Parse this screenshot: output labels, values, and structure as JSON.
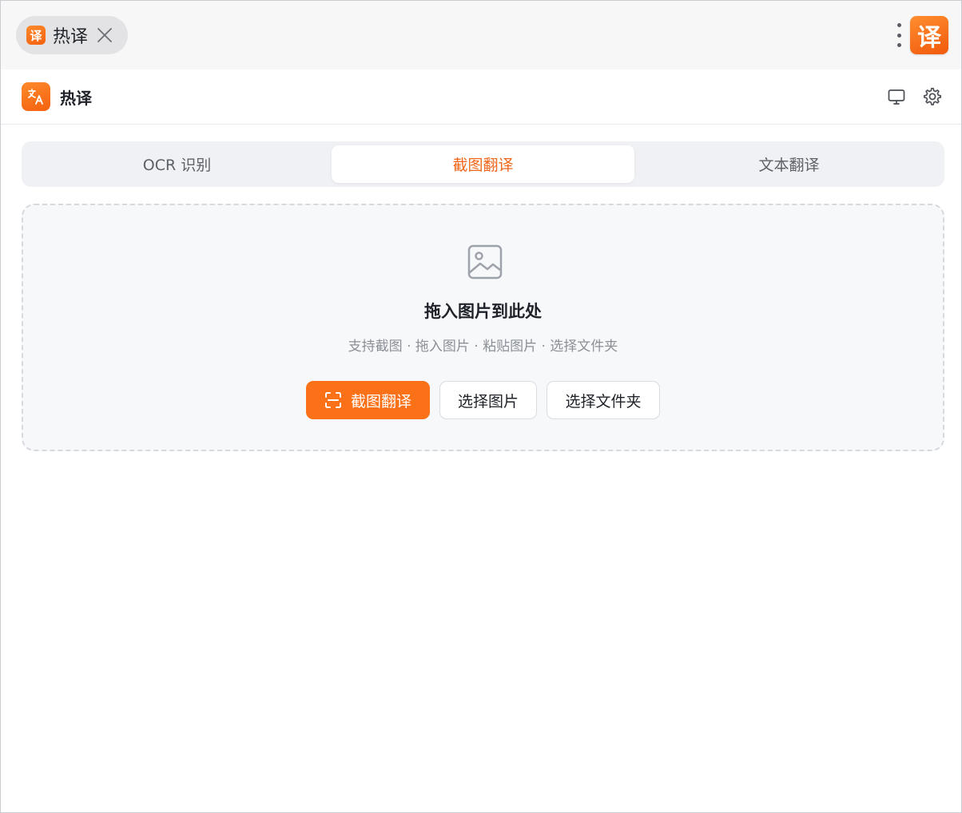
{
  "titlebar": {
    "tab_logo_glyph": "译",
    "tab_title": "热译",
    "app_badge_glyph": "译",
    "close_icon": "close-icon",
    "menu_icon": "more-vertical-icon"
  },
  "header": {
    "app_name": "热译",
    "logo_icon": "translate-icon",
    "monitor_icon": "monitor-icon",
    "settings_icon": "gear-icon"
  },
  "tabs": [
    {
      "label": "OCR 识别",
      "active": false
    },
    {
      "label": "截图翻译",
      "active": true
    },
    {
      "label": "文本翻译",
      "active": false
    }
  ],
  "dropzone": {
    "icon": "image-icon",
    "title": "拖入图片到此处",
    "subtitle": "支持截图 · 拖入图片 · 粘贴图片 · 选择文件夹",
    "buttons": {
      "screenshot_translate": "截图翻译",
      "select_image": "选择图片",
      "select_folder": "选择文件夹"
    }
  },
  "colors": {
    "accent": "#fb7118",
    "accent_text": "#f0661a",
    "segment_bg": "#f0f1f4",
    "dropzone_bg": "#f7f8fa"
  }
}
